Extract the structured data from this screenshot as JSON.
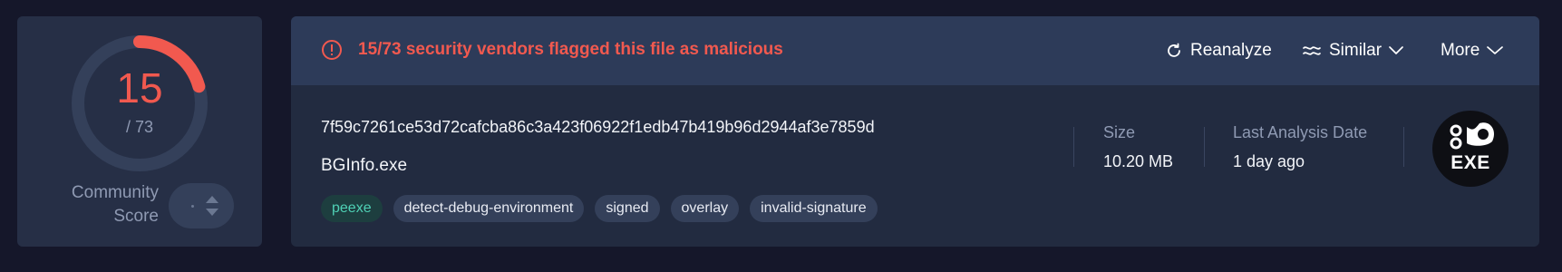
{
  "score": {
    "detections": "15",
    "total_label": "/ 73",
    "detections_value": 15,
    "total_value": 73,
    "accent_color": "#f1594f",
    "community_label": "Community\nScore",
    "community_line1": "Community",
    "community_line2": "Score"
  },
  "banner": {
    "alert_text": "15/73 security vendors flagged this file as malicious",
    "reanalyze_label": "Reanalyze",
    "similar_label": "Similar",
    "more_label": "More"
  },
  "file": {
    "hash": "7f59c7261ce53d72cafcba86c3a423f06922f1edb47b419b96d2944af3e7859d",
    "name": "BGInfo.exe",
    "tags": [
      "peexe",
      "detect-debug-environment",
      "signed",
      "overlay",
      "invalid-signature"
    ]
  },
  "meta": {
    "size_label": "Size",
    "size_value": "10.20 MB",
    "date_label": "Last Analysis Date",
    "date_value": "1 day ago"
  },
  "filetype_badge": {
    "label": "EXE",
    "icon": "gears-exe-icon"
  }
}
